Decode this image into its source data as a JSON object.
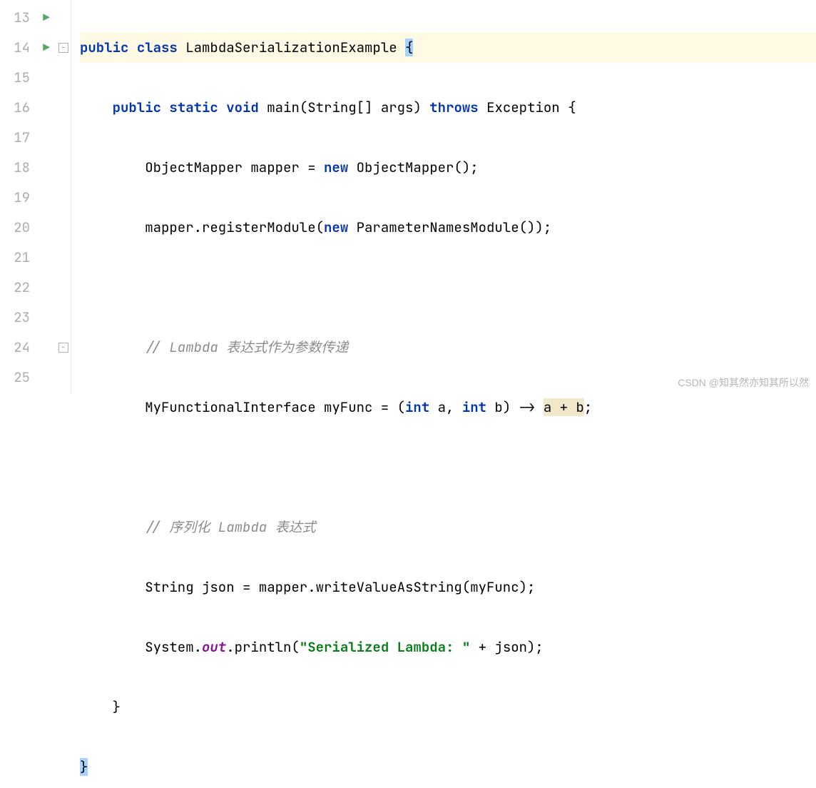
{
  "lineNumbers": [
    "13",
    "14",
    "15",
    "16",
    "17",
    "18",
    "19",
    "20",
    "21",
    "22",
    "23",
    "24",
    "25"
  ],
  "code": {
    "l13_public": "public",
    "l13_class": "class",
    "l13_name": "LambdaSerializationExample",
    "l13_brace": "{",
    "l14_public": "public",
    "l14_static": "static",
    "l14_void": "void",
    "l14_main": "main(String[] args)",
    "l14_throws": "throws",
    "l14_exc": "Exception {",
    "l15_a": "ObjectMapper mapper = ",
    "l15_new": "new",
    "l15_b": " ObjectMapper();",
    "l16_a": "mapper.registerModule(",
    "l16_new": "new",
    "l16_b": " ParameterNamesModule());",
    "l18_comment": "// Lambda 表达式作为参数传递",
    "l19_a": "MyFunctionalInterface myFunc = (",
    "l19_int1": "int",
    "l19_mid1": " a, ",
    "l19_int2": "int",
    "l19_mid2": " b) -> ",
    "l19_expr": "a + b",
    "l19_semi": ";",
    "l21_comment": "// 序列化 Lambda 表达式",
    "l22": "String json = mapper.writeValueAsString(myFunc);",
    "l23_a": "System.",
    "l23_out": "out",
    "l23_b": ".println(",
    "l23_str": "\"Serialized Lambda: \"",
    "l23_c": " + json);",
    "l24": "}",
    "l25": "}"
  },
  "watermark": "CSDN @知其然亦知其所以然"
}
